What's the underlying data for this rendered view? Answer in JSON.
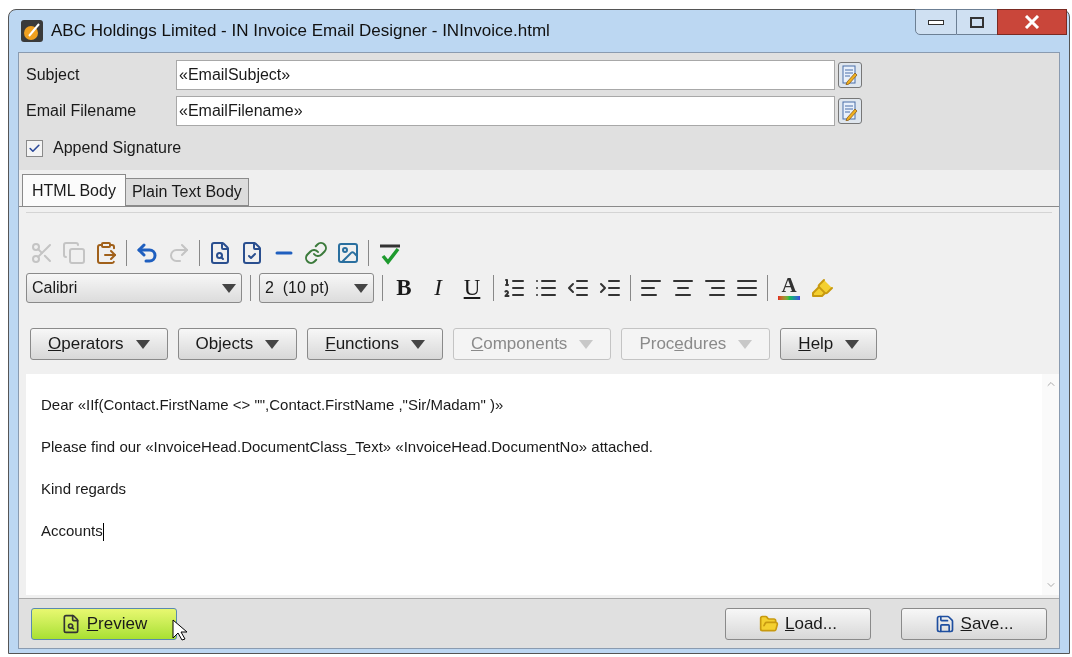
{
  "window": {
    "title": "ABC Holdings Limited - IN Invoice Email Designer - INInvoice.html"
  },
  "fields": [
    {
      "label": "Subject",
      "value": "«EmailSubject»"
    },
    {
      "label": "Email Filename",
      "value": "«EmailFilename»"
    }
  ],
  "append_signature": {
    "label": "Append Signature",
    "checked": true
  },
  "tabs": [
    {
      "label": "HTML Body",
      "selected": true
    },
    {
      "label": "Plain Text Body",
      "selected": false
    }
  ],
  "toolbar": [
    {
      "kind": "cut",
      "disabled": true
    },
    {
      "kind": "copy",
      "disabled": true
    },
    {
      "kind": "paste",
      "disabled": false
    },
    {
      "kind": "separator"
    },
    {
      "kind": "undo",
      "disabled": false
    },
    {
      "kind": "redo",
      "disabled": true
    },
    {
      "kind": "separator"
    },
    {
      "kind": "find",
      "disabled": false
    },
    {
      "kind": "replace",
      "disabled": false
    },
    {
      "kind": "rule",
      "disabled": false
    },
    {
      "kind": "link",
      "disabled": false
    },
    {
      "kind": "image",
      "disabled": false
    },
    {
      "kind": "separator"
    },
    {
      "kind": "spell",
      "disabled": false
    }
  ],
  "font": {
    "name": "Calibri",
    "size": "2  (10 pt)"
  },
  "format": [
    {
      "kind": "bold",
      "text": "B"
    },
    {
      "kind": "italic",
      "text": "I"
    },
    {
      "kind": "underline",
      "text": "U"
    },
    {
      "kind": "separator"
    },
    {
      "kind": "numbered"
    },
    {
      "kind": "bullets"
    },
    {
      "kind": "outdent"
    },
    {
      "kind": "indent"
    },
    {
      "kind": "separator"
    },
    {
      "kind": "align-left"
    },
    {
      "kind": "align-center"
    },
    {
      "kind": "align-right"
    },
    {
      "kind": "justify"
    },
    {
      "kind": "separator"
    },
    {
      "kind": "text-color",
      "text": "A"
    },
    {
      "kind": "highlight"
    }
  ],
  "menus": [
    {
      "key": "O",
      "post": "perators",
      "disabled": false
    },
    {
      "pre": "Objects",
      "disabled": false
    },
    {
      "key": "F",
      "post": "unctions",
      "disabled": false
    },
    {
      "key": "C",
      "post": "omponents",
      "disabled": true
    },
    {
      "pre": "Proc",
      "key": "e",
      "post": "dures",
      "disabled": true
    },
    {
      "key": "H",
      "post": "elp",
      "disabled": false
    }
  ],
  "body": [
    "Dear «IIf(Contact.FirstName <> \"\",Contact.FirstName ,\"Sir/Madam\" )»",
    "Please find our «InvoiceHead.DocumentClass_Text» «InvoiceHead.DocumentNo» attached.",
    "Kind regards",
    "Accounts"
  ],
  "buttons": [
    {
      "kind": "preview",
      "key": "P",
      "post": "review",
      "hovered": true
    },
    {
      "kind": "load",
      "key": "L",
      "post": "oad...",
      "hovered": false
    },
    {
      "kind": "save",
      "key": "S",
      "post": "ave...",
      "hovered": false
    }
  ]
}
